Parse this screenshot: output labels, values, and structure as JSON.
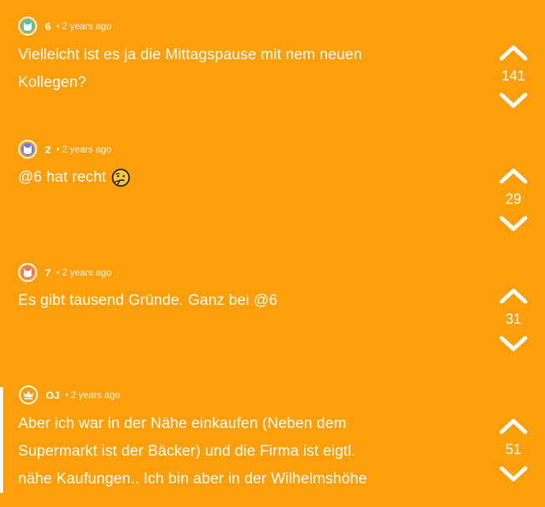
{
  "comments": [
    {
      "author": "6",
      "time": "2 years ago",
      "avatar_color": "#3EC5C4",
      "avatar_icon": "cat-icon",
      "lines": [
        "Vielleicht ist es ja die Mittagspause mit nem neuen",
        "Kollegen?"
      ],
      "emoji": "",
      "votes": "141"
    },
    {
      "author": "2",
      "time": "2 years ago",
      "avatar_color": "#6C7CF2",
      "avatar_icon": "cat-icon",
      "lines": [
        "@6 hat recht"
      ],
      "emoji": "thinking-face-icon",
      "votes": "29"
    },
    {
      "author": "7",
      "time": "2 years ago",
      "avatar_color": "#F0706E",
      "avatar_icon": "cat-icon",
      "lines": [
        "Es gibt tausend Gründe. Ganz bei @6"
      ],
      "emoji": "",
      "votes": "31"
    },
    {
      "author": "OJ",
      "time": "2 years ago",
      "avatar_color": "#FF9E0B",
      "avatar_icon": "crown-icon",
      "lines": [
        "Aber ich war in der Nähe einkaufen (Neben dem",
        "Supermarkt ist der Bäcker) und die Firma ist eigtl.",
        "nähe Kaufungen.. Ich bin aber in der Wilhelmshöhe"
      ],
      "emoji": "",
      "votes": "51"
    }
  ],
  "separator": "•",
  "colors": {
    "background": "#FF9E0B",
    "text": "#ffffff"
  }
}
